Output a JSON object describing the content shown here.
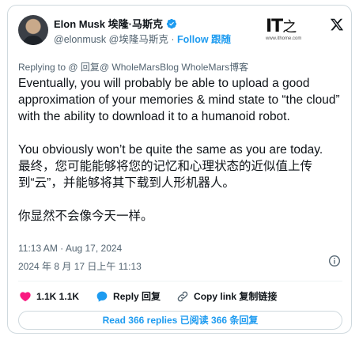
{
  "author": {
    "name": "Elon Musk 埃隆·马斯克",
    "handle": "@elonmusk @埃隆马斯克",
    "separator": "·",
    "follow_label": "Follow 跟随"
  },
  "watermark": {
    "logo_text": "IT之家",
    "logo_mark": "IT",
    "logo_url": "www.ithome.com"
  },
  "tweet": {
    "replying_to": "Replying to @ 回复@ WholeMarsBlog WholeMars博客",
    "paragraph1": "Eventually, you will probably be able to upload a good approximation of your memories & mind state to “the cloud” with the ability to download it to a humanoid robot.",
    "paragraph2": "You obviously won’t be quite the same as you are today.",
    "paragraph3": "最终，您可能能够将您的记忆和心理状态的近似值上传到“云”，并能够将其下载到人形机器人。",
    "paragraph4": "你显然不会像今天一样。",
    "time_en": "11:13 AM · Aug 17, 2024",
    "time_cn": "2024 年 8 月 17 日上午 11:13"
  },
  "actions": {
    "like_label": "1.1K 1.1K",
    "reply_label": "Reply 回复",
    "copy_label": "Copy link 复制链接"
  },
  "read_replies_label": "Read 366 replies 已阅读 366 条回复",
  "colors": {
    "accent": "#1d9bf0",
    "like": "#f91880",
    "text": "#0f1419",
    "muted": "#536471"
  }
}
